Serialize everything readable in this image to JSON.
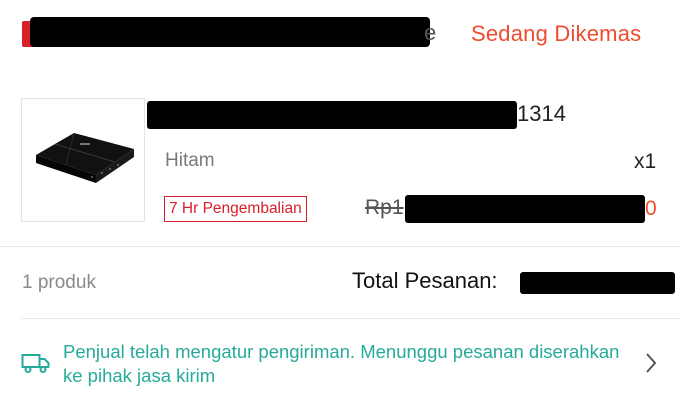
{
  "header": {
    "shop_name_tail": "e",
    "status": "Sedang Dikemas",
    "colors": {
      "brand_red": "#d8202c",
      "status_orange": "#ee4d2d"
    }
  },
  "product": {
    "thumbnail_icon": "induction-cooker-image",
    "name_tail": "1314",
    "variant": "Hitam",
    "quantity": "x1",
    "return_badge": "7 Hr Pengembalian",
    "price_original_prefix": "Rp1",
    "price_tail": "0"
  },
  "totals": {
    "count": "1 produk",
    "label": "Total Pesanan:"
  },
  "shipping": {
    "icon": "truck-icon",
    "message": "Penjual telah mengatur pengiriman. Menunggu pesanan diserahkan ke pihak jasa kirim",
    "color": "#26aa99",
    "chevron_icon": "chevron-right-icon"
  }
}
